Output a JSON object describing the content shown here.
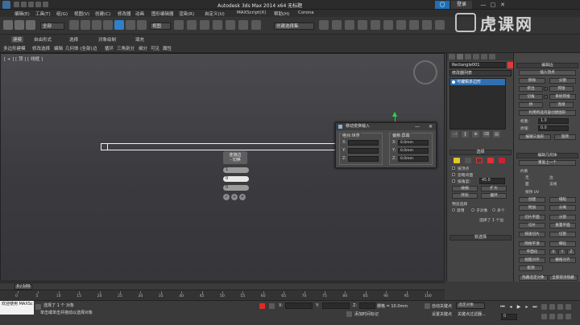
{
  "window": {
    "title": "Autodesk 3ds Max  2014 x64        无标题",
    "help_label": "◯",
    "login_label": "登录",
    "minimize": "—",
    "maximize": "▢",
    "close": "✕"
  },
  "menu": [
    "编辑(E)",
    "工具(T)",
    "组(G)",
    "视图(V)",
    "创建(C)",
    "修改器",
    "动画",
    "图形编辑器",
    "渲染(R)",
    "自定义(U)",
    "MAXScript(X)",
    "帮助(H)",
    "Corona"
  ],
  "toolbar": {
    "undo_group": "全部",
    "selection_set": "创建选择集",
    "view_dropdown": "视图"
  },
  "ribbon": {
    "tabs": [
      "建模",
      "自由形式",
      "选择",
      "对象绘制",
      "填充"
    ],
    "groups": [
      "多边形建模",
      "修改选择",
      "编辑",
      "几何体（全部）",
      "边",
      "循环",
      "三角剖分",
      "细分",
      "可见",
      "属性"
    ],
    "row_labels": [
      "多边形建模",
      "修改选择",
      "编辑",
      "几何体 (全部)",
      "边",
      "循环",
      "三角剖分",
      "细分",
      "可见",
      "属性"
    ]
  },
  "viewport": {
    "label": "[ + ] [ 顶 ] [ 线框 ]",
    "colors": {
      "gizmo_x": "#e02a2a",
      "gizmo_y": "#2fd34a"
    }
  },
  "caddy": {
    "title": "连接边",
    "title2": "- 切换",
    "fields": [
      "1",
      "0",
      "0"
    ],
    "confirm_icons": [
      "✓",
      "+",
      "✕"
    ]
  },
  "dialog": {
    "title": "移动变换输入",
    "minimize": "—",
    "close": "✕",
    "absolute_group": "绝对:世界",
    "offset_group": "偏移:屏幕",
    "axes": [
      "X:",
      "Y:",
      "Z:"
    ],
    "absolute_values": [
      "",
      "",
      ""
    ],
    "offset_values": [
      "0.0mm",
      "0.0mm",
      "0.0mm"
    ]
  },
  "command_panel": {
    "object_name": "Rectangle001",
    "modifier_list": "修改器列表",
    "stack_items": [
      "可编辑多边形"
    ],
    "stack_buttons": [
      "⊣",
      "‖",
      "⊕",
      "⌫",
      "▤"
    ],
    "selection_rollout": "选择",
    "subobject_colors": [
      "#e2c72a",
      "#d33",
      "#d33"
    ],
    "options": [
      "按顶点",
      "忽略背面",
      "按角度:",
      "45.0"
    ],
    "shrink_grow": [
      "收缩",
      "扩大",
      "环形",
      "循环"
    ],
    "preview_title": "预览选择",
    "preview_opts": [
      "禁用",
      "子对象",
      "多个"
    ],
    "selected_count": "选择了 1 个边",
    "soft_select": "软选择"
  },
  "edit_panel": {
    "title": "编辑边",
    "items": [
      "插入顶点",
      "移除",
      "分割",
      "挤出",
      "焊接",
      "切角",
      "目标焊接",
      "桥",
      "连接",
      "利用所选内容创建图形",
      "权重:",
      "1.0",
      "折缝:",
      "0.0",
      "编辑三角形",
      "旋转",
      "编辑几何体",
      "重复上一个",
      "约束",
      "无",
      "边",
      "面",
      "法线",
      "保持 UV",
      "创建",
      "塌陷",
      "附加",
      "分离",
      "切片平面",
      "分割",
      "切片",
      "重置平面",
      "快速切片",
      "切割",
      "网格平滑",
      "细化",
      "平面化",
      "X",
      "Y",
      "Z",
      "视图对齐",
      "栅格对齐",
      "松弛",
      "隐藏选定对象",
      "全部取消隐藏",
      "隐藏未选定对象",
      "命名选择:"
    ]
  },
  "timeline": {
    "slider_label": "0 / 100",
    "ticks": [
      "0",
      "5",
      "10",
      "15",
      "20",
      "25",
      "30",
      "35",
      "40",
      "45",
      "50",
      "55",
      "60",
      "65",
      "70",
      "75",
      "80",
      "85",
      "90",
      "95",
      "100"
    ]
  },
  "status": {
    "maxscript_line1": "欢迎使用 MAXSc",
    "selected": "选择了 1 个 对象",
    "prompt": "单击或单击并拖动以选择对象",
    "x_label": "X:",
    "y_label": "Y:",
    "z_label": "Z:",
    "grid": "栅格 = 10.0mm",
    "auto_key": "自动关键点",
    "set_key": "设置关键点",
    "selection_dropdown": "选定对象",
    "key_filters": "关键点过滤器...",
    "add_time_tag": "添加时间标记",
    "frame": "0"
  },
  "watermark": "虎课网"
}
